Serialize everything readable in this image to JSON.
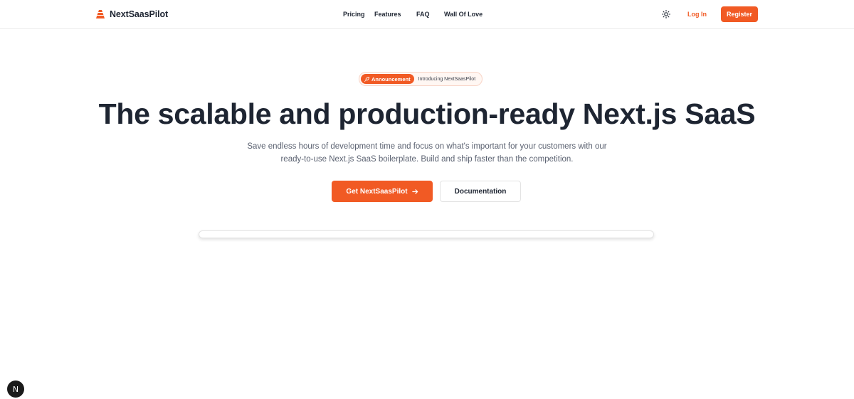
{
  "brand": {
    "name": "NextSaasPilot",
    "logo_icon": "pyramid-logo-icon",
    "accent_color": "#f15a24"
  },
  "nav": {
    "items": [
      {
        "label": "Pricing"
      },
      {
        "label": "Features"
      },
      {
        "label": "FAQ"
      },
      {
        "label": "Wall Of Love"
      }
    ]
  },
  "header_actions": {
    "theme_icon": "sun-icon",
    "login_label": "Log In",
    "register_label": "Register"
  },
  "announcement": {
    "tag_icon": "rocket-icon",
    "tag_label": "Announcement",
    "text": "Introducing NextSaasPilot"
  },
  "hero": {
    "title": "The scalable and production-ready Next.js SaaS",
    "subtitle": "Save endless hours of development time and focus on what's important for your customers with our ready-to-use Next.js SaaS boilerplate. Build and ship faster than the competition.",
    "primary_cta": "Get NextSaasPilot",
    "primary_cta_icon": "arrow-right-icon",
    "secondary_cta": "Documentation"
  },
  "dev_indicator": {
    "label": "N"
  }
}
